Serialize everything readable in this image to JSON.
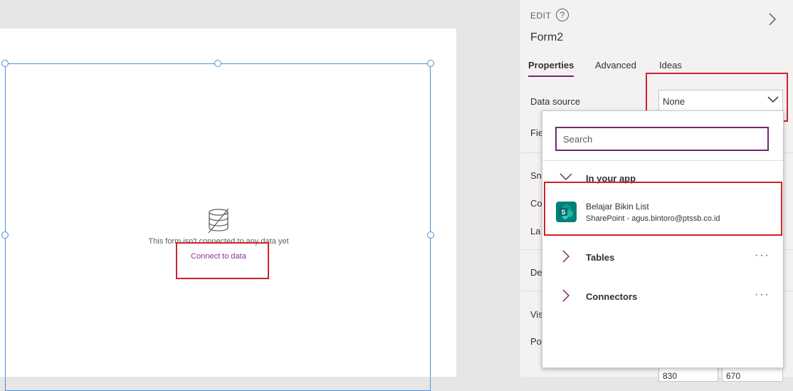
{
  "canvas": {
    "empty_message": "This form isn't connected to any data yet",
    "connect_link": "Connect to data"
  },
  "panel": {
    "mode_label": "EDIT",
    "help_glyph": "?",
    "control_name": "Form2",
    "tabs": [
      {
        "label": "Properties",
        "active": true
      },
      {
        "label": "Advanced",
        "active": false
      },
      {
        "label": "Ideas",
        "active": false
      }
    ],
    "data_source": {
      "label": "Data source",
      "value": "None"
    },
    "partial_labels": [
      "Fie",
      "Sn",
      "Co",
      "La",
      "De",
      "Vis",
      "Po"
    ],
    "partial_values": [
      "830",
      "670"
    ]
  },
  "dropdown": {
    "search_placeholder": "Search",
    "section_in_app": "In your app",
    "item": {
      "name": "Belajar Bikin List",
      "subtitle": "SharePoint - agus.bintoro@ptssb.co.id",
      "icon": "sharepoint-icon"
    },
    "section_tables": "Tables",
    "section_connectors": "Connectors",
    "more_glyph": "···"
  },
  "colors": {
    "accent": "#742774",
    "highlight_box": "#d0222a",
    "selection_border": "#4a90d9",
    "sharepoint": "#037f77"
  }
}
